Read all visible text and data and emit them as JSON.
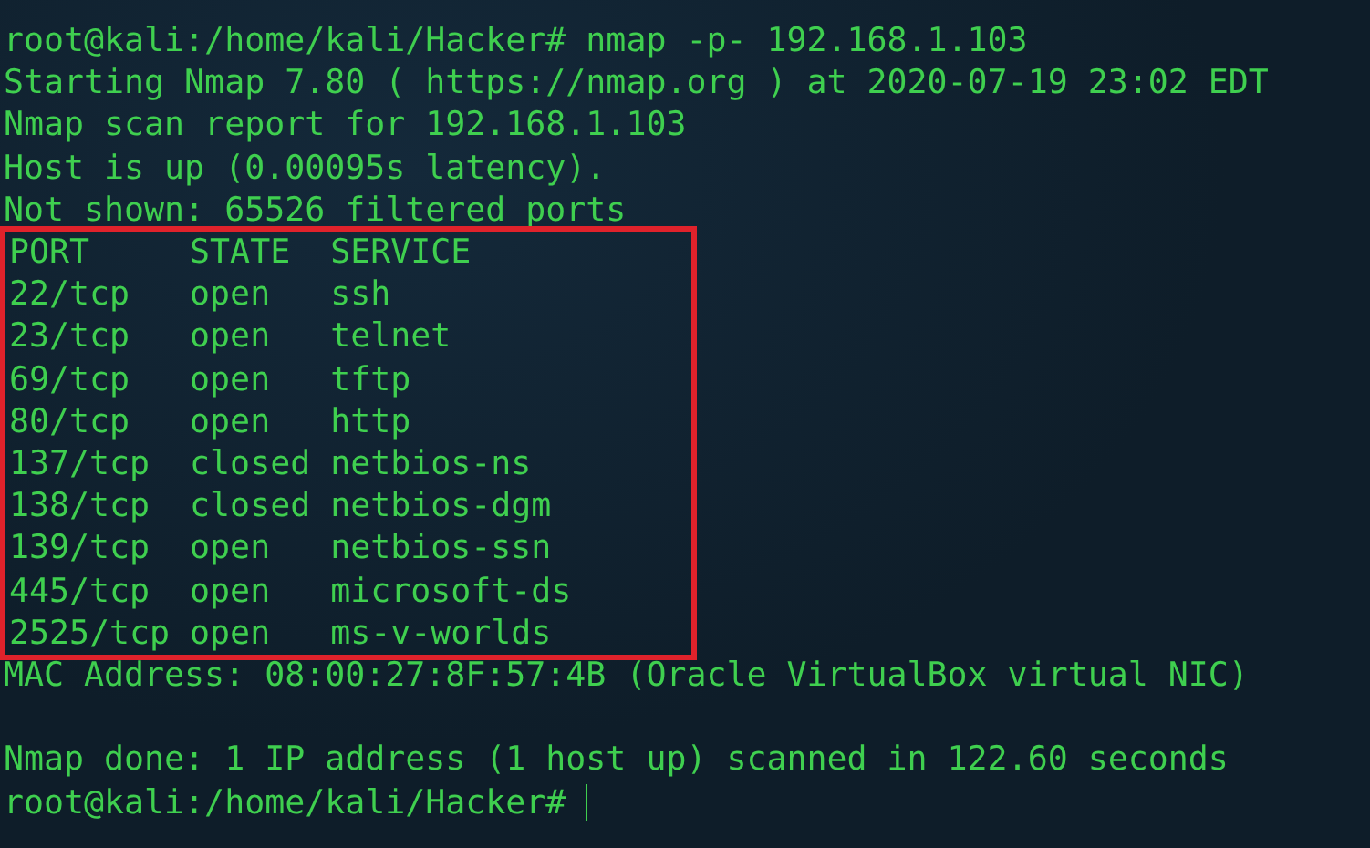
{
  "terminal": {
    "lines_before": [
      "root@kali:/home/kali/Hacker# nmap -p- 192.168.1.103",
      "Starting Nmap 7.80 ( https://nmap.org ) at 2020-07-19 23:02 EDT",
      "Nmap scan report for 192.168.1.103",
      "Host is up (0.00095s latency).",
      "Not shown: 65526 filtered ports"
    ],
    "port_table": {
      "highlighted": true,
      "columns": [
        "PORT",
        "STATE",
        "SERVICE"
      ],
      "rows": [
        [
          "22/tcp",
          "open",
          "ssh"
        ],
        [
          "23/tcp",
          "open",
          "telnet"
        ],
        [
          "69/tcp",
          "open",
          "tftp"
        ],
        [
          "80/tcp",
          "open",
          "http"
        ],
        [
          "137/tcp",
          "closed",
          "netbios-ns"
        ],
        [
          "138/tcp",
          "closed",
          "netbios-dgm"
        ],
        [
          "139/tcp",
          "open",
          "netbios-ssn"
        ],
        [
          "445/tcp",
          "open",
          "microsoft-ds"
        ],
        [
          "2525/tcp",
          "open",
          "ms-v-worlds"
        ]
      ]
    },
    "mac_line": "MAC Address: 08:00:27:8F:57:4B (Oracle VirtualBox virtual NIC)",
    "summary_line": "Nmap done: 1 IP address (1 host up) scanned in 122.60 seconds",
    "prompt": "root@kali:/home/kali/Hacker#",
    "cursor": true
  }
}
